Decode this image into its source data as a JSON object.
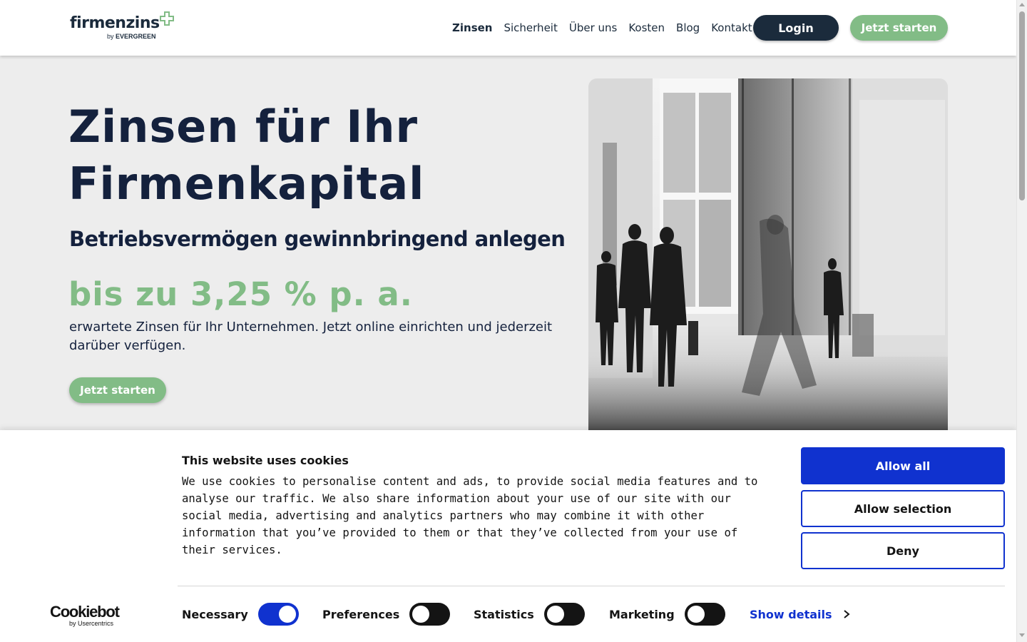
{
  "header": {
    "logo": {
      "word": "firmenzins",
      "sub_prefix": "by",
      "sub_brand": "EVERGREEN"
    },
    "nav": [
      {
        "label": "Zinsen",
        "active": true
      },
      {
        "label": "Sicherheit",
        "active": false
      },
      {
        "label": "Über uns",
        "active": false
      },
      {
        "label": "Kosten",
        "active": false
      },
      {
        "label": "Blog",
        "active": false
      },
      {
        "label": "Kontakt",
        "active": false
      }
    ],
    "login_label": "Login",
    "start_label": "Jetzt starten"
  },
  "hero": {
    "title_line1": "Zinsen für Ihr",
    "title_line2": "Firmenkapital",
    "subtitle": "Betriebsvermögen gewinnbringend anlegen",
    "rate": "bis zu 3,25 % p. a.",
    "text": "erwartete Zinsen für Ihr Unternehmen. Jetzt online einrichten und jederzeit darüber verfügen.",
    "cta_label": "Jetzt starten"
  },
  "cookie_banner": {
    "title": "This website uses cookies",
    "text": "We use cookies to personalise content and ads, to provide social media features and to analyse our traffic. We also share information about your use of our site with our social media, advertising and analytics partners who may combine it with other information that you’ve provided to them or that they’ve collected from your use of their services.",
    "allow_all": "Allow all",
    "allow_selection": "Allow selection",
    "deny": "Deny",
    "logo_word": "Cookiebot",
    "logo_sub": "by Usercentrics",
    "categories": [
      {
        "label": "Necessary",
        "checked": true
      },
      {
        "label": "Preferences",
        "checked": false
      },
      {
        "label": "Statistics",
        "checked": false
      },
      {
        "label": "Marketing",
        "checked": false
      }
    ],
    "show_details": "Show details"
  },
  "colors": {
    "navy": "#14213d",
    "green": "#82bc86",
    "cookiebot_blue": "#1032cf",
    "hero_bg": "#ededed"
  }
}
